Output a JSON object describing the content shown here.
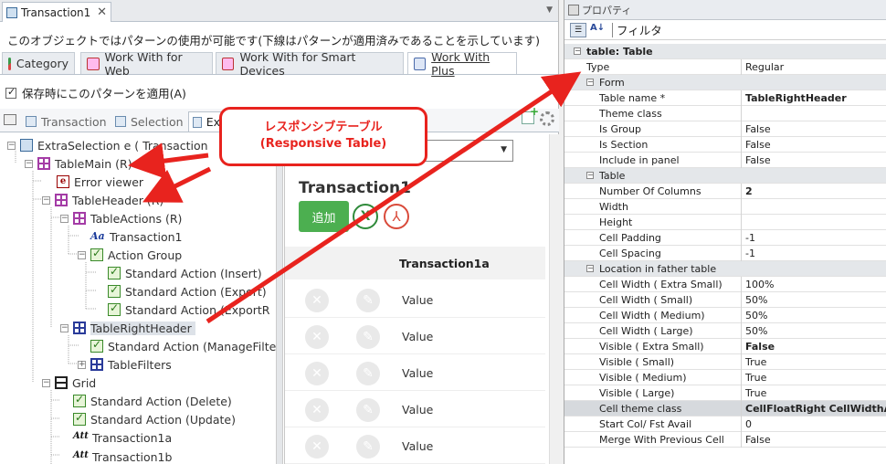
{
  "doc_tab": {
    "title": "Transaction1",
    "close_label": "✕"
  },
  "info_text": "このオブジェクトではパターンの使用が可能です(下線はパターンが適用済みであることを示しています)",
  "pattern_tabs": [
    "Category",
    "Work With for Web",
    "Work With for Smart Devices",
    "Work With Plus"
  ],
  "apply_checkbox_label": "保存時にこのパターンを適用(A)",
  "sub_tabs": [
    "Transaction",
    "Selection",
    "Ex"
  ],
  "tree": {
    "root": "ExtraSelection e ( Transaction",
    "items": [
      "TableMain (R)",
      "Error viewer",
      "TableHeader (R)",
      "TableActions (R)",
      "Transaction1",
      "Action Group",
      "Standard Action (Insert)",
      "Standard Action (Export)",
      "Standard Action (ExportR",
      "TableRightHeader",
      "Standard Action (ManageFilte",
      "TableFilters",
      "Grid",
      "Standard Action (Delete)",
      "Standard Action (Update)",
      "Transaction1a",
      "Transaction1b"
    ]
  },
  "preview": {
    "title": "Transaction1",
    "add_button": "追加",
    "column_header": "Transaction1a",
    "rows": [
      "Value",
      "Value",
      "Value",
      "Value",
      "Value"
    ]
  },
  "callout": {
    "line1": "レスポンシブテーブル",
    "line2": "(Responsive  Table)"
  },
  "properties": {
    "title": "プロパティ",
    "filter_label": "フィルタ",
    "header": "table: Table",
    "rows": [
      {
        "k": "Type",
        "v": "Regular"
      },
      {
        "k": "Form",
        "v": ""
      },
      {
        "k": "Table name *",
        "v": "TableRightHeader"
      },
      {
        "k": "Theme class",
        "v": ""
      },
      {
        "k": "Is Group",
        "v": "False"
      },
      {
        "k": "Is Section",
        "v": "False"
      },
      {
        "k": "Include in panel",
        "v": "False"
      },
      {
        "k": "Table",
        "v": ""
      },
      {
        "k": "Number Of Columns",
        "v": "2"
      },
      {
        "k": "Width",
        "v": ""
      },
      {
        "k": "Height",
        "v": ""
      },
      {
        "k": "Cell Padding",
        "v": "-1"
      },
      {
        "k": "Cell Spacing",
        "v": "-1"
      },
      {
        "k": "Location in father table",
        "v": ""
      },
      {
        "k": "Cell Width ( Extra Small)",
        "v": "100%"
      },
      {
        "k": "Cell Width ( Small)",
        "v": "50%"
      },
      {
        "k": "Cell Width ( Medium)",
        "v": "50%"
      },
      {
        "k": "Cell Width ( Large)",
        "v": "50%"
      },
      {
        "k": "Visible ( Extra Small)",
        "v": "False"
      },
      {
        "k": "Visible ( Small)",
        "v": "True"
      },
      {
        "k": "Visible ( Medium)",
        "v": "True"
      },
      {
        "k": "Visible ( Large)",
        "v": "True"
      },
      {
        "k": "Cell theme class",
        "v": "CellFloatRight CellWidthAut"
      },
      {
        "k": "Start Col/ Fst Avail",
        "v": "0"
      },
      {
        "k": "Merge With Previous Cell",
        "v": "False"
      }
    ]
  },
  "colors": {
    "annotation_red": "#e8231e",
    "add_green": "#4caf50"
  }
}
